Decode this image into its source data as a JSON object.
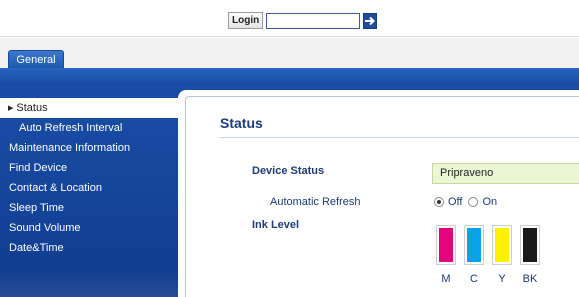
{
  "header": {
    "login_label": "Login",
    "login_input_value": "",
    "go_icon": "arrow-right-icon"
  },
  "tabs": [
    {
      "label": "General",
      "active": true
    }
  ],
  "sidebar": {
    "items": [
      {
        "label": "Status",
        "active": true,
        "sub": false
      },
      {
        "label": "Auto Refresh Interval",
        "active": false,
        "sub": true
      },
      {
        "label": "Maintenance Information",
        "active": false,
        "sub": false
      },
      {
        "label": "Find Device",
        "active": false,
        "sub": false
      },
      {
        "label": "Contact & Location",
        "active": false,
        "sub": false
      },
      {
        "label": "Sleep Time",
        "active": false,
        "sub": false
      },
      {
        "label": "Sound Volume",
        "active": false,
        "sub": false
      },
      {
        "label": "Date&Time",
        "active": false,
        "sub": false
      }
    ]
  },
  "main": {
    "title": "Status",
    "device_status_label": "Device Status",
    "device_status_value": "Pripraveno",
    "auto_refresh_label": "Automatic Refresh",
    "auto_refresh_options": [
      {
        "label": "Off",
        "checked": true
      },
      {
        "label": "On",
        "checked": false
      }
    ],
    "ink_level_label": "Ink Level",
    "inks": [
      {
        "label": "M",
        "color": "#e2057e",
        "level": 0.95
      },
      {
        "label": "C",
        "color": "#0aa3e8",
        "level": 0.95
      },
      {
        "label": "Y",
        "color": "#fff100",
        "level": 0.95
      },
      {
        "label": "BK",
        "color": "#1a1a1a",
        "level": 0.95
      }
    ]
  },
  "colors": {
    "brand_blue": "#1a4fa6",
    "title_blue": "#1d3c78",
    "status_green": "#eaf7d2"
  }
}
